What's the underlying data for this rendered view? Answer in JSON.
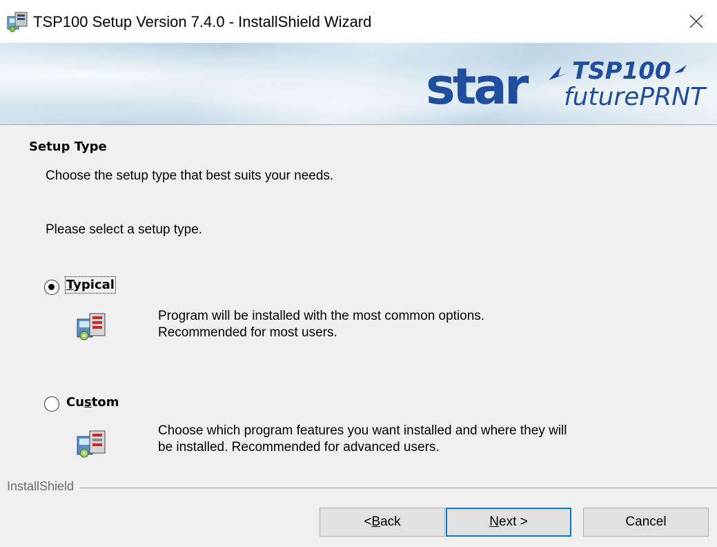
{
  "window": {
    "title": "TSP100 Setup Version 7.4.0 - InstallShield Wizard",
    "close_glyph": "✕"
  },
  "banner": {
    "logo_brand": "star",
    "logo_model": "TSP100",
    "logo_product": "futurePRNT"
  },
  "page": {
    "section_title": "Setup Type",
    "section_desc": "Choose the setup type that best suits your needs.",
    "prompt": "Please select a setup type."
  },
  "options": [
    {
      "label_pre": "",
      "label_mnemonic": "T",
      "label_post": "ypical",
      "selected": true,
      "icon": "setup-typical-icon",
      "desc_line1": "Program will be installed with the most common options.",
      "desc_line2": "Recommended for most users."
    },
    {
      "label_pre": "Cu",
      "label_mnemonic": "s",
      "label_post": "tom",
      "selected": false,
      "icon": "setup-custom-icon",
      "desc_line1": "Choose which program features you want installed and where they will",
      "desc_line2": "be installed. Recommended for advanced users."
    }
  ],
  "footer": {
    "brand": "InstallShield",
    "back": {
      "pre": "< ",
      "mnemonic": "B",
      "post": "ack"
    },
    "next": {
      "pre": "",
      "mnemonic": "N",
      "post": "ext >"
    },
    "cancel": "Cancel"
  },
  "colors": {
    "accent": "#0078d7",
    "banner_blue": "#b8d2e3",
    "logo_blue": "#1f4e9e"
  }
}
